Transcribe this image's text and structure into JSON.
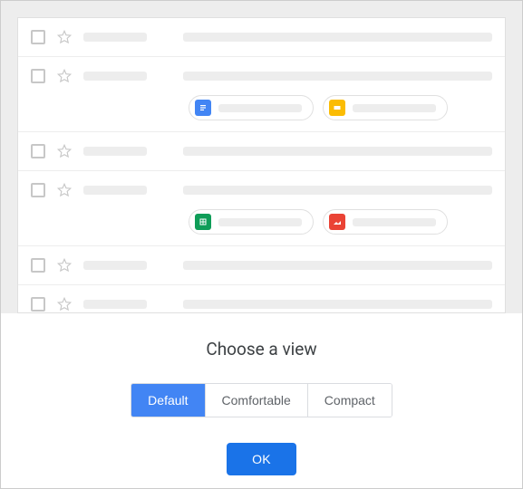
{
  "title": "Choose a view",
  "view_options": {
    "default": "Default",
    "comfortable": "Comfortable",
    "compact": "Compact"
  },
  "selected_view": "default",
  "confirm_label": "OK",
  "preview_rows": [
    {
      "has_attachments": false
    },
    {
      "has_attachments": true,
      "attachments": [
        {
          "icon": "docs",
          "color": "#4285f4"
        },
        {
          "icon": "slides",
          "color": "#fbbc04"
        }
      ]
    },
    {
      "has_attachments": false
    },
    {
      "has_attachments": true,
      "attachments": [
        {
          "icon": "sheets",
          "color": "#0f9d58"
        },
        {
          "icon": "image",
          "color": "#ea4335"
        }
      ]
    },
    {
      "has_attachments": false
    },
    {
      "has_attachments": false
    }
  ],
  "icon_colors": {
    "docs": "#4285f4",
    "slides": "#fbbc04",
    "sheets": "#0f9d58",
    "image": "#ea4335"
  }
}
